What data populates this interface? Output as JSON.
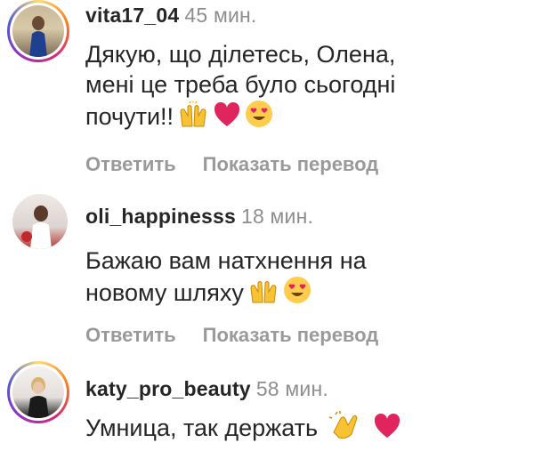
{
  "comments": [
    {
      "username": "vita17_04",
      "time": "45 мин.",
      "text_lines": [
        "Дякую, що ділетесь, Олена,",
        "мені це треба було сьогодні",
        "почути!!"
      ],
      "emojis": [
        "raised-hands-icon",
        "red-heart-icon",
        "heart-eyes-icon"
      ],
      "reply_label": "Ответить",
      "translate_label": "Показать перевод"
    },
    {
      "username": "oli_happinesss",
      "time": "18 мин.",
      "text_lines": [
        "Бажаю вам натхнення на",
        "новому шляху"
      ],
      "emojis": [
        "raised-hands-icon",
        "heart-eyes-icon"
      ],
      "reply_label": "Ответить",
      "translate_label": "Показать перевод"
    },
    {
      "username": "katy_pro_beauty",
      "time": "58 мин.",
      "text_lines": [
        "Умница, так держать"
      ],
      "emojis": [
        "clapping-hands-icon",
        "red-heart-icon"
      ]
    }
  ],
  "colors": {
    "username": "#262626",
    "meta": "#8e8e8e",
    "heart": "#e0245e"
  }
}
